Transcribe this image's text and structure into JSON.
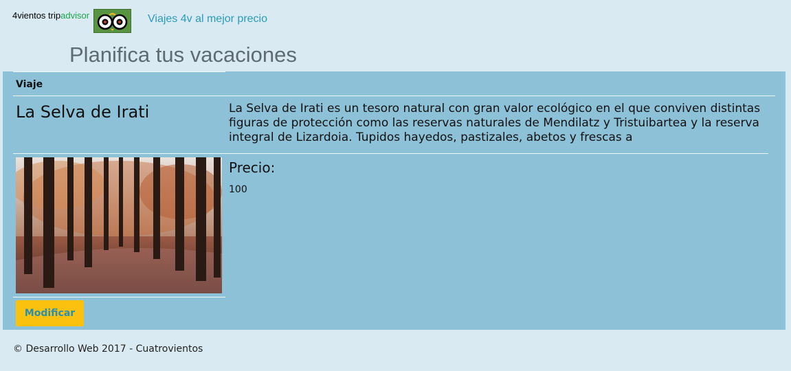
{
  "header": {
    "brand_main": "4vientos",
    "brand_trip": "trip",
    "brand_advisor": "advisor",
    "nav_link": "Viajes 4v al mejor precio",
    "logo_icon": "tripadvisor-owl-icon"
  },
  "page": {
    "title": "Planifica tus vacaciones"
  },
  "table": {
    "column_header": "Viaje",
    "trip": {
      "name": "La Selva de Irati",
      "description": "La Selva de Irati es un tesoro natural con gran valor ecológico en el que conviven distintas figuras de protección como las reservas naturales de Mendilatz y Tristuibartea y la reserva integral de Lizardoia. Tupidos hayedos, pastizales, abetos y frescas a",
      "price_label": "Precio:",
      "price_value": "100",
      "photo": "autumn-beech-forest-photo"
    },
    "modify_button": "Modificar"
  },
  "footer": {
    "text": "© Desarrollo Web 2017 - Cuatrovientos"
  },
  "colors": {
    "page_bg": "#d9eaf2",
    "panel_bg": "#8dc1d7",
    "link": "#2b9bb5",
    "button_bg": "#fbc10f",
    "button_text": "#2b8fb0",
    "advisor_green": "#1aa548"
  }
}
